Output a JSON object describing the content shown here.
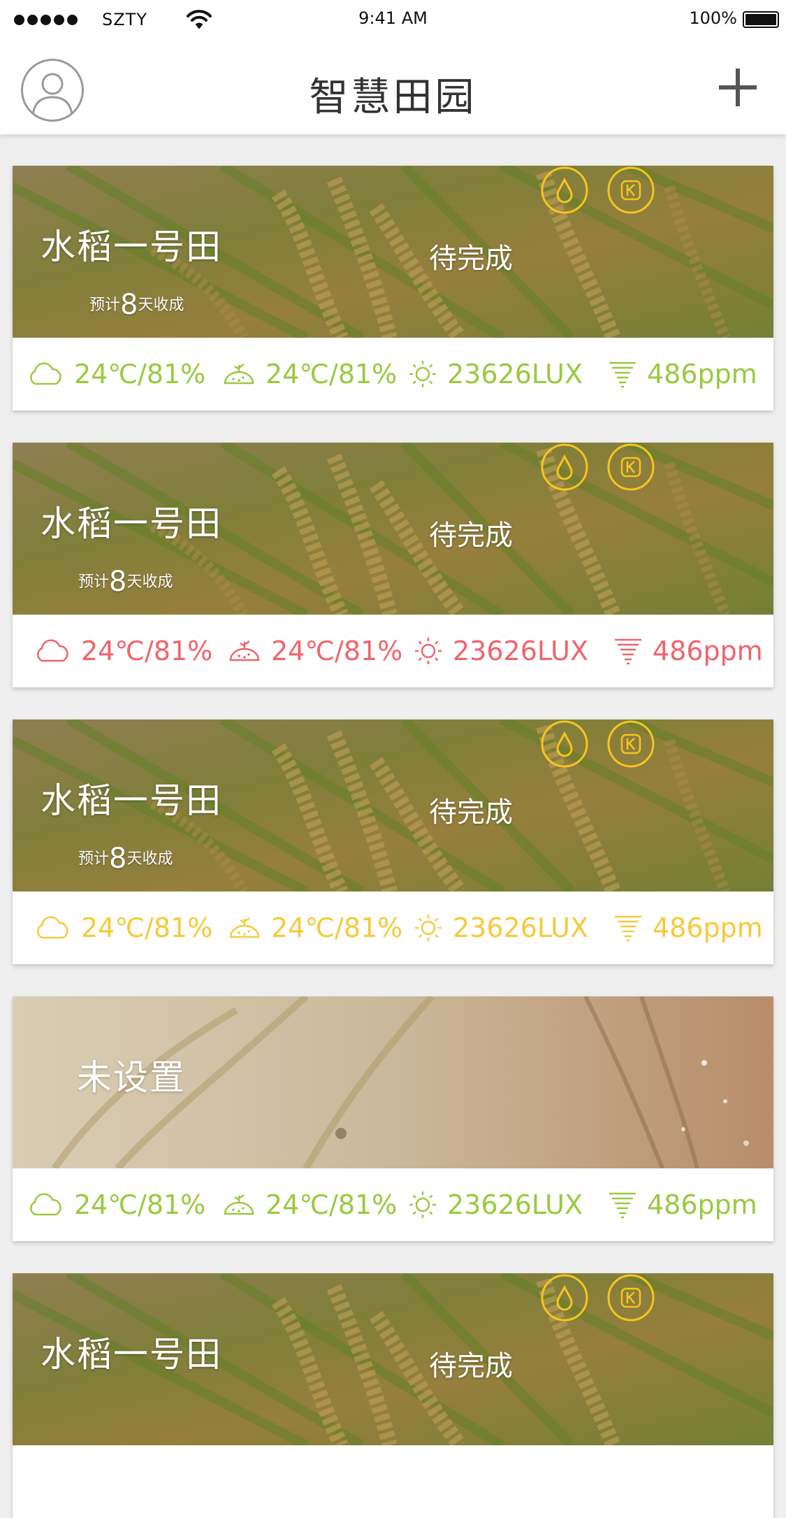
{
  "status_bar": {
    "carrier": "SZTY",
    "time": "9:41 AM",
    "battery": "100%"
  },
  "nav": {
    "title": "智慧田园"
  },
  "colors": {
    "green": "#9ac940",
    "red": "#f0646c",
    "yellow": "#f7c93a",
    "badge": "#f7c51e"
  },
  "cards": [
    {
      "name": "水稻一号田",
      "harvest_prefix": "预计",
      "harvest_days": "8",
      "harvest_suffix": "天收成",
      "state": "待完成",
      "stats": {
        "air": "24℃/81%",
        "soil": "24℃/81%",
        "light": "23626LUX",
        "co2": "486ppm"
      },
      "stat_color": "green"
    },
    {
      "name": "水稻一号田",
      "harvest_prefix": "预计",
      "harvest_days": "8",
      "harvest_suffix": "天收成",
      "state": "待完成",
      "stats": {
        "air": "24℃/81%",
        "soil": "24℃/81%",
        "light": "23626LUX",
        "co2": "486ppm"
      },
      "stat_color": "red"
    },
    {
      "name": "水稻一号田",
      "harvest_prefix": "预计",
      "harvest_days": "8",
      "harvest_suffix": "天收成",
      "state": "待完成",
      "stats": {
        "air": "24℃/81%",
        "soil": "24℃/81%",
        "light": "23626LUX",
        "co2": "486ppm"
      },
      "stat_color": "yellow"
    },
    {
      "name": "未设置",
      "stats": {
        "air": "24℃/81%",
        "soil": "24℃/81%",
        "light": "23626LUX",
        "co2": "486ppm"
      },
      "stat_color": "green"
    },
    {
      "name": "水稻一号田",
      "state": "待完成"
    }
  ],
  "icons": {
    "air": "cloud-icon",
    "soil": "soil-sprout-icon",
    "light": "sun-icon",
    "co2": "co2-funnel-icon",
    "water": "water-drop-icon",
    "k": "potassium-icon",
    "avatar": "user-avatar-icon",
    "add": "plus-icon"
  }
}
